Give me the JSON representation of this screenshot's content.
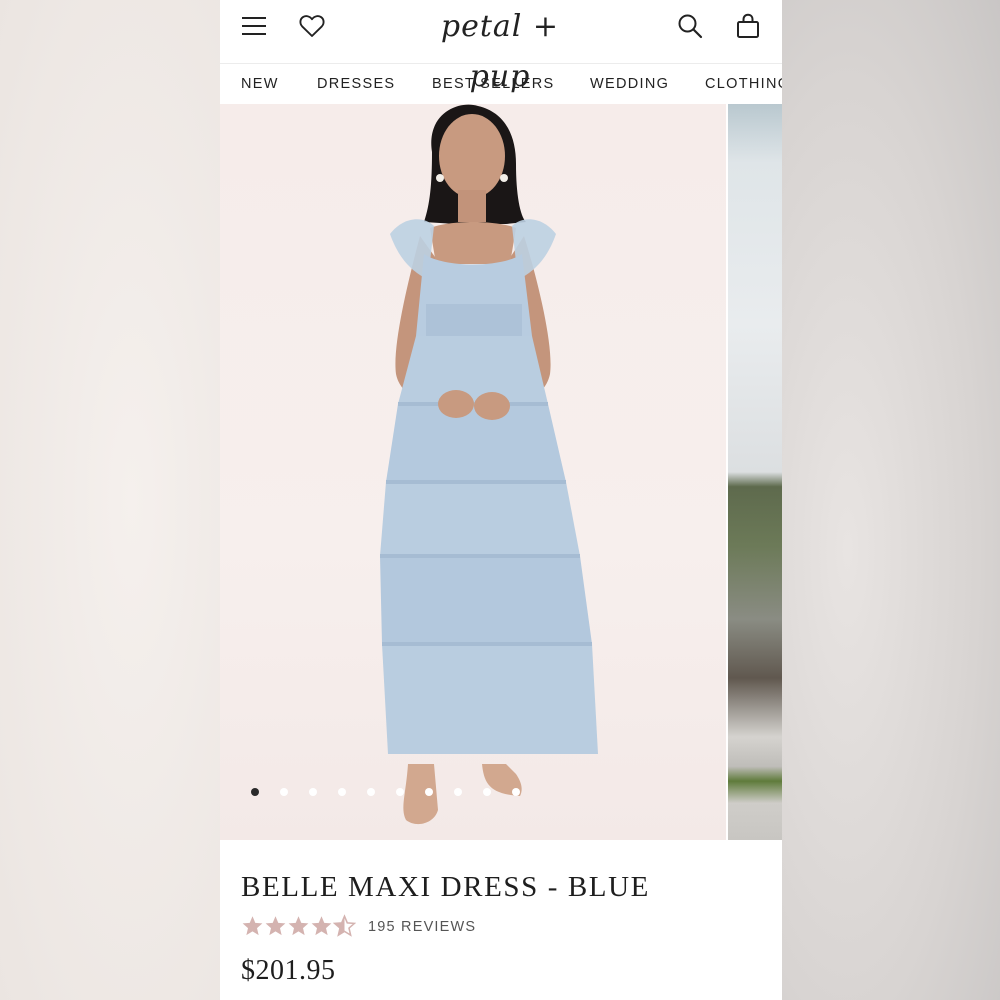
{
  "header": {
    "brand": "petal + pup",
    "icons": [
      "menu-icon",
      "heart-icon",
      "search-icon",
      "bag-icon"
    ]
  },
  "nav": {
    "items": [
      "NEW",
      "DRESSES",
      "BEST SELLERS",
      "WEDDING",
      "CLOTHING"
    ]
  },
  "gallery": {
    "slide_count": 10,
    "active_index": 0
  },
  "product": {
    "title": "BELLE MAXI DRESS - BLUE",
    "rating": 4.5,
    "reviews": "195 REVIEWS",
    "price": "$201.95"
  },
  "colors": {
    "star": "#d4b3b0",
    "text": "#1e1e1e",
    "dress": "#b9cde0"
  }
}
